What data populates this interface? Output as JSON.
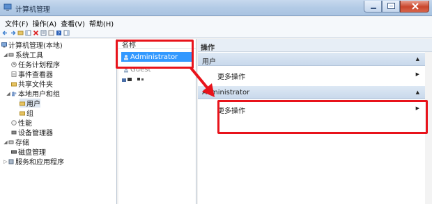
{
  "window": {
    "title": "计算机管理"
  },
  "menu": [
    "文件(F)",
    "操作(A)",
    "查看(V)",
    "帮助(H)"
  ],
  "tree": {
    "items": [
      {
        "label": "计算机管理(本地)",
        "depth": 0,
        "glyph": ""
      },
      {
        "label": "系统工具",
        "depth": 1,
        "glyph": "◢"
      },
      {
        "label": "任务计划程序",
        "depth": 2,
        "glyph": ""
      },
      {
        "label": "事件查看器",
        "depth": 2,
        "glyph": ""
      },
      {
        "label": "共享文件夹",
        "depth": 2,
        "glyph": ""
      },
      {
        "label": "本地用户和组",
        "depth": 2,
        "glyph": "◢"
      },
      {
        "label": "用户",
        "depth": 3,
        "glyph": ""
      },
      {
        "label": "组",
        "depth": 3,
        "glyph": ""
      },
      {
        "label": "性能",
        "depth": 2,
        "glyph": ""
      },
      {
        "label": "设备管理器",
        "depth": 2,
        "glyph": ""
      },
      {
        "label": "存储",
        "depth": 1,
        "glyph": "◢"
      },
      {
        "label": "磁盘管理",
        "depth": 2,
        "glyph": ""
      },
      {
        "label": "服务和应用程序",
        "depth": 1,
        "glyph": "▷"
      }
    ]
  },
  "list": {
    "header": "名称",
    "rows": [
      {
        "label": "Administrator"
      },
      {
        "label": "Guest"
      }
    ]
  },
  "actions": {
    "header": "操作",
    "sections": [
      {
        "title": "用户",
        "arrow": "▲",
        "items": [
          {
            "label": "更多操作",
            "arrow": "▶"
          }
        ]
      },
      {
        "title": "Administrator",
        "arrow": "▲",
        "items": [
          {
            "label": "更多操作",
            "arrow": "▶"
          }
        ]
      }
    ]
  },
  "colors": {
    "highlight": "#e8131b",
    "selection": "#3399ff"
  }
}
